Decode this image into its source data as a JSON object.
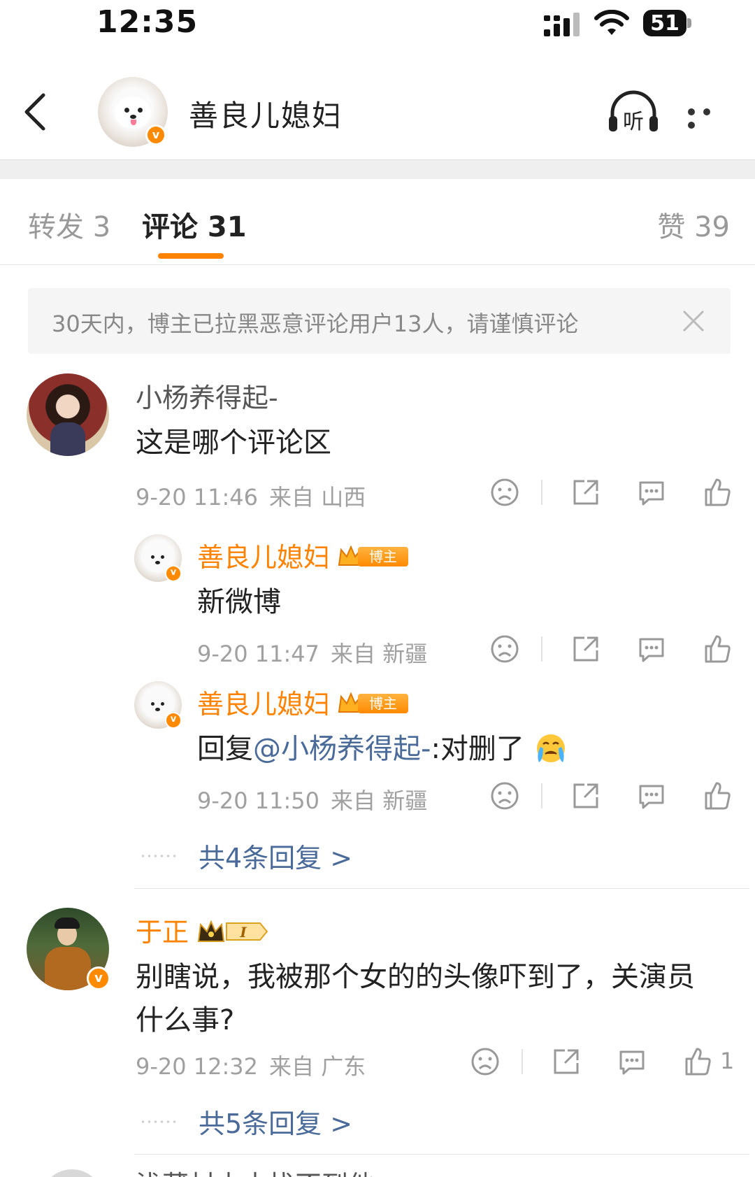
{
  "status_bar": {
    "time": "12:35",
    "battery": "51"
  },
  "header": {
    "title": "善良儿媳妇",
    "listen_label": "听"
  },
  "tabs": {
    "repost": "转发 3",
    "comments": "评论 31",
    "likes": "赞 39"
  },
  "notice": {
    "text": "30天内，博主已拉黑恶意评论用户13人，请谨慎评论"
  },
  "host_badge": "博主",
  "comments": [
    {
      "user": "小杨养得起-",
      "text": "这是哪个评论区",
      "time": "9-20 11:46",
      "location": "来自 山西",
      "replies": [
        {
          "user": "善良儿媳妇",
          "text": "新微博",
          "time": "9-20 11:47",
          "location": "来自 新疆"
        },
        {
          "user": "善良儿媳妇",
          "reply_prefix": "回复",
          "mention": "@小杨养得起-",
          "text": ":对删了",
          "time": "9-20 11:50",
          "location": "来自 新疆"
        }
      ],
      "more_replies": "共4条回复 >"
    },
    {
      "user": "于正",
      "vip_level": "I",
      "text_line1": "别瞎说，我被那个女的的头像吓到了，关演员",
      "text_line2": "什么事?",
      "time": "9-20 12:32",
      "location": "来自 广东",
      "likes": "1",
      "more_replies": "共5条回复 >"
    }
  ],
  "peek_text": "浅藏村本本找不到他"
}
